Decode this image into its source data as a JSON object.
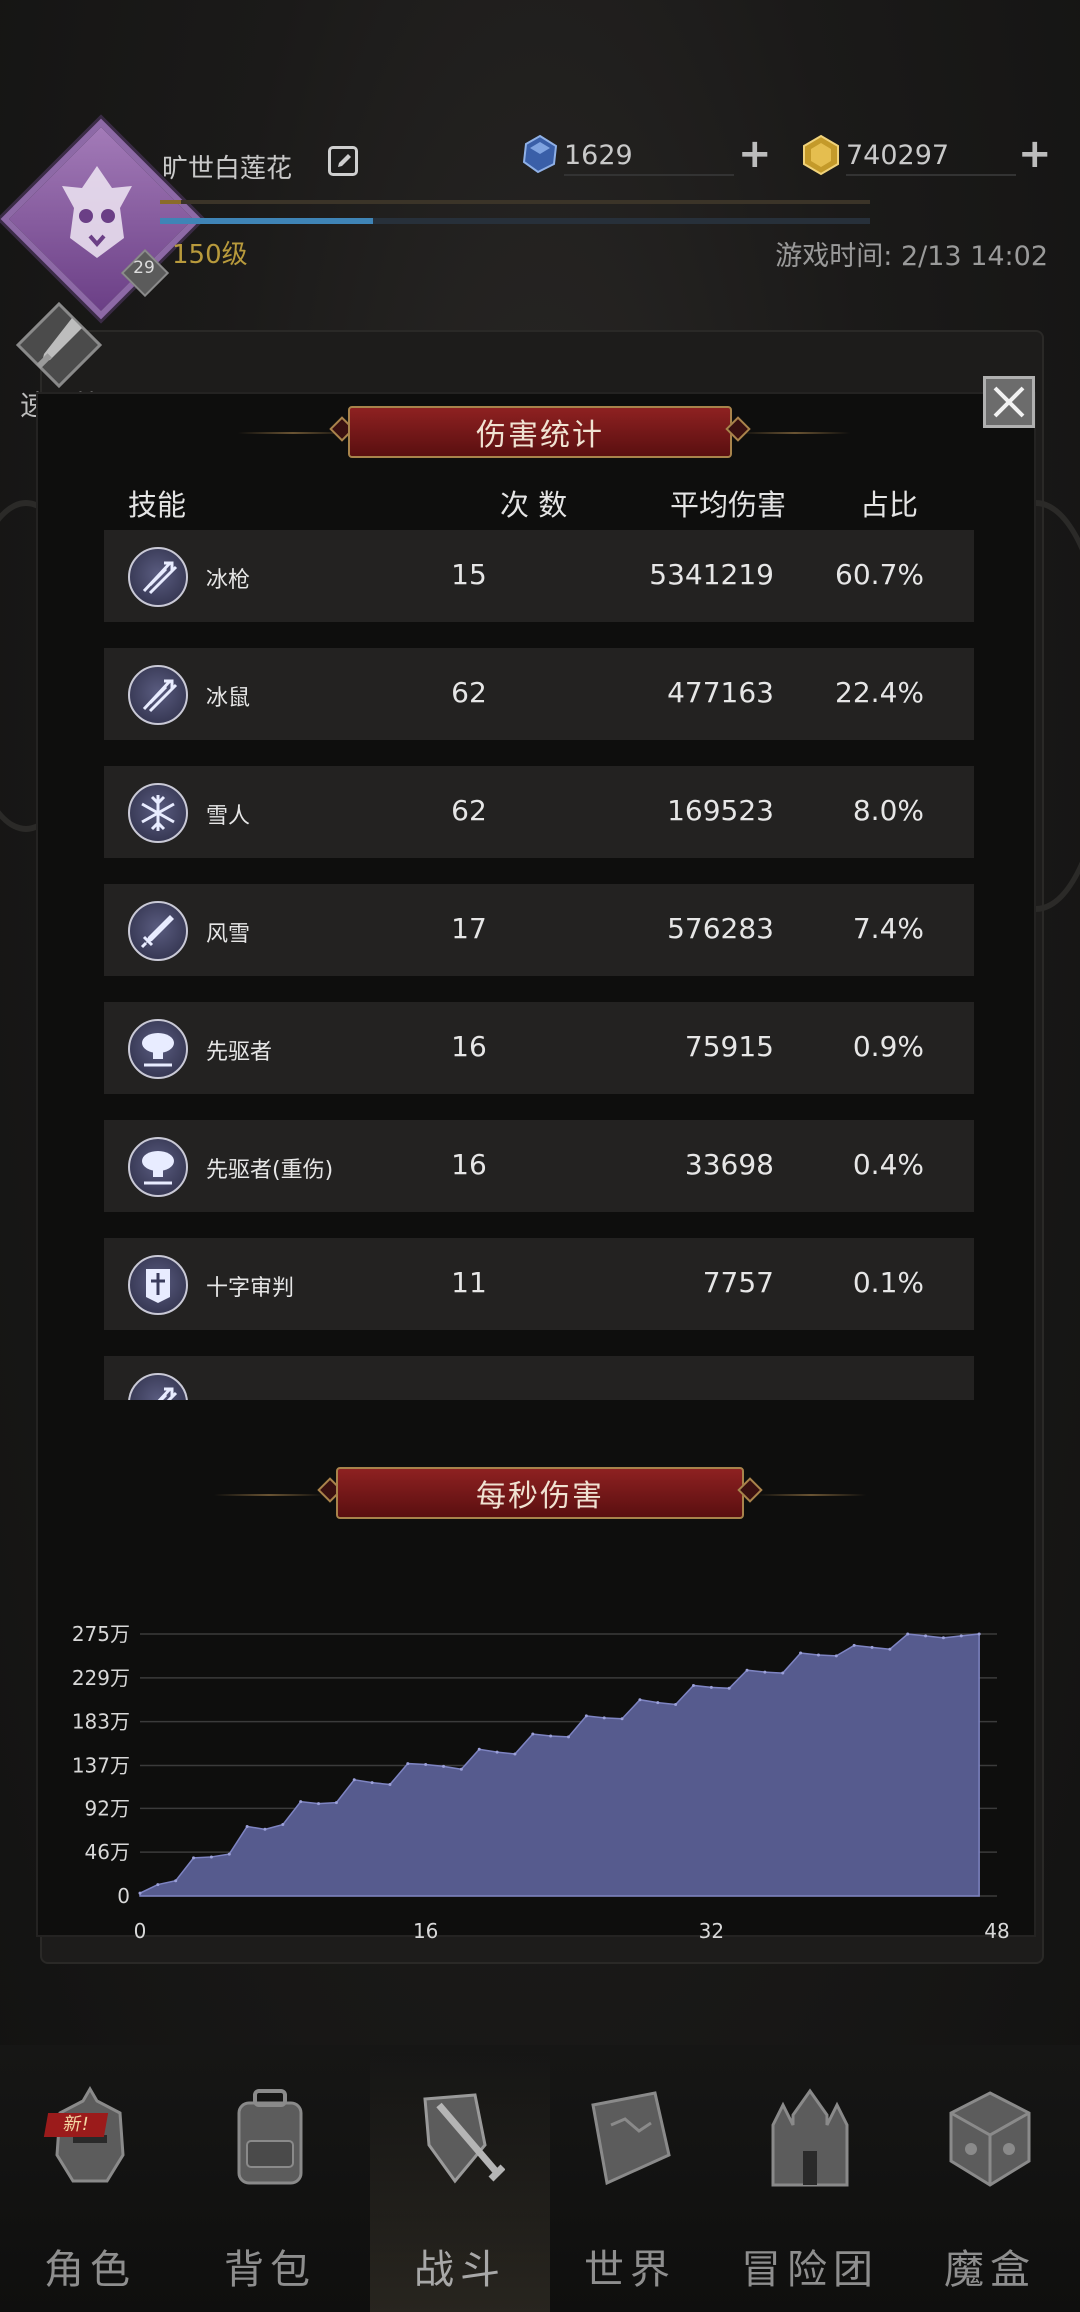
{
  "header": {
    "player_name": "旷世白莲花",
    "level_badge": "29",
    "level_text": "150级",
    "game_time": "游戏时间: 2/13 14:02",
    "gems": "1629",
    "gold": "740297",
    "exp_progress": 0.03,
    "hp_progress": 0.3,
    "quick_battle_label": "速 战"
  },
  "damage_stats": {
    "title": "伤害统计",
    "columns": {
      "skill": "技能",
      "count": "次 数",
      "avg": "平均伤害",
      "ratio": "占比"
    },
    "rows": [
      {
        "icon": "ice-spear-icon",
        "name": "冰枪",
        "count": "15",
        "avg": "5341219",
        "ratio": "60.7%"
      },
      {
        "icon": "ice-spear-icon",
        "name": "冰鼠",
        "count": "62",
        "avg": "477163",
        "ratio": "22.4%"
      },
      {
        "icon": "snowflake-icon",
        "name": "雪人",
        "count": "62",
        "avg": "169523",
        "ratio": "8.0%"
      },
      {
        "icon": "sword-icon",
        "name": "风雪",
        "count": "17",
        "avg": "576283",
        "ratio": "7.4%"
      },
      {
        "icon": "mushroom-cloud-icon",
        "name": "先驱者",
        "count": "16",
        "avg": "75915",
        "ratio": "0.9%"
      },
      {
        "icon": "mushroom-cloud-icon",
        "name": "先驱者(重伤)",
        "count": "16",
        "avg": "33698",
        "ratio": "0.4%"
      },
      {
        "icon": "banner-icon",
        "name": "十字审判",
        "count": "11",
        "avg": "7757",
        "ratio": "0.1%"
      },
      {
        "icon": "ice-spear-icon",
        "name": "",
        "count": "",
        "avg": "",
        "ratio": ""
      }
    ]
  },
  "dps": {
    "title": "每秒伤害"
  },
  "chart_data": {
    "type": "area",
    "title": "每秒伤害",
    "xlabel": "",
    "ylabel": "",
    "xlim": [
      0,
      48
    ],
    "ylim": [
      0,
      275
    ],
    "x_ticks": [
      "0",
      "16",
      "32",
      "48"
    ],
    "y_ticks": [
      "0",
      "46万",
      "92万",
      "137万",
      "183万",
      "229万",
      "275万"
    ],
    "y_unit": "万",
    "grid": true,
    "color": "#565b8e",
    "x": [
      0,
      1,
      2,
      3,
      4,
      5,
      6,
      7,
      8,
      9,
      10,
      11,
      12,
      13,
      14,
      15,
      16,
      17,
      18,
      19,
      20,
      21,
      22,
      23,
      24,
      25,
      26,
      27,
      28,
      29,
      30,
      31,
      32,
      33,
      34,
      35,
      36,
      37,
      38,
      39,
      40,
      41,
      42,
      43,
      44,
      45,
      46,
      47
    ],
    "values": [
      3,
      12,
      16,
      40,
      41,
      44,
      73,
      70,
      75,
      99,
      97,
      98,
      122,
      119,
      117,
      139,
      138,
      136,
      133,
      154,
      151,
      149,
      170,
      168,
      167,
      189,
      187,
      186,
      206,
      203,
      201,
      221,
      219,
      218,
      237,
      235,
      234,
      255,
      253,
      252,
      263,
      261,
      259,
      275,
      273,
      271,
      273,
      275
    ]
  },
  "nav": {
    "items": [
      {
        "label": "角色",
        "icon": "helmet-icon",
        "new": "新!"
      },
      {
        "label": "背包",
        "icon": "backpack-icon"
      },
      {
        "label": "战斗",
        "icon": "sword-shield-icon"
      },
      {
        "label": "世界",
        "icon": "map-scroll-icon"
      },
      {
        "label": "冒险团",
        "icon": "castle-icon"
      },
      {
        "label": "魔盒",
        "icon": "cube-icon"
      }
    ]
  },
  "colors": {
    "banner": "#7a1818",
    "chart_fill": "#565b8e",
    "row_bg": "#232221",
    "level_gold": "#b89a3c"
  }
}
